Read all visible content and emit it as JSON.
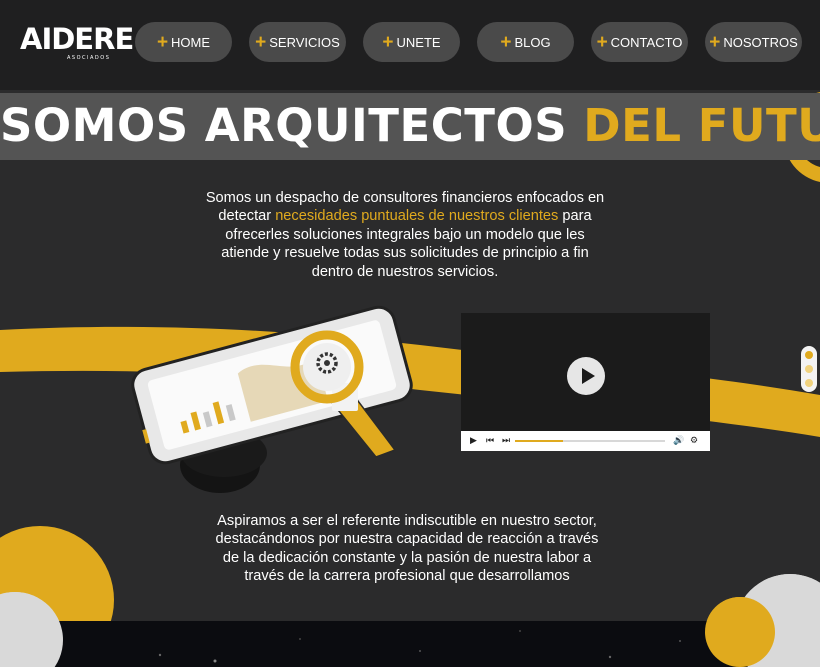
{
  "brand": {
    "name": "AIDERE",
    "tagline": "ASOCIADOS"
  },
  "nav": {
    "items": [
      {
        "label": "HOME"
      },
      {
        "label": "SERVICIOS"
      },
      {
        "label": "UNETE"
      },
      {
        "label": "BLOG"
      },
      {
        "label": "CONTACTO"
      },
      {
        "label": "NOSOTROS"
      }
    ]
  },
  "hero": {
    "title_main": "SOMOS ARQUITECTOS",
    "title_accent": "DEL FUTURO"
  },
  "intro": {
    "before": "Somos un despacho de consultores financieros enfocados en detectar ",
    "highlight": "necesidades puntuales de nuestros clientes",
    "after": " para ofrecerles soluciones integrales bajo un modelo que les atiende y resuelve todas sus solicitudes de principio a fin dentro de nuestros servicios."
  },
  "video": {
    "progress": 0.32
  },
  "mission": {
    "text": "Aspiramos a ser el referente indiscutible en nuestro sector, destacándonos por nuestra capacidad de reacción a través de la dedicación constante y la pasión de nuestra labor a través de la carrera profesional que desarrollamos"
  },
  "colors": {
    "accent": "#e0aa1e",
    "background": "#2b2b2c",
    "nav_button": "#4a4a4a",
    "hero_band": "#545454"
  }
}
